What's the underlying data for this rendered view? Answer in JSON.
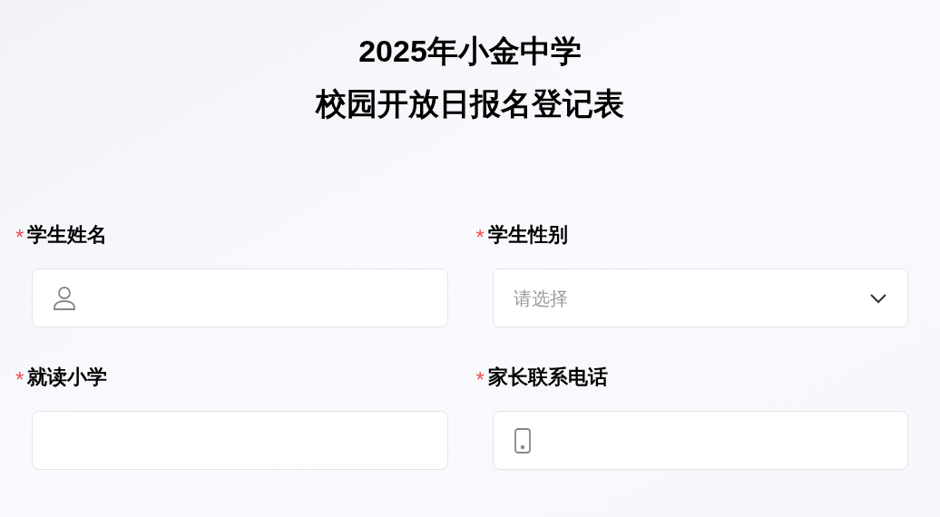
{
  "title_lines": [
    "2025年小金中学",
    "校园开放日报名登记表"
  ],
  "fields": [
    {
      "label": "学生姓名",
      "marker": "*",
      "kind": "person"
    },
    {
      "label": "学生性别",
      "marker": "*",
      "kind": "select",
      "placeholder": "请选择"
    },
    {
      "label": "就读小学",
      "marker": "*",
      "kind": "plain"
    },
    {
      "label": "家长联系电话",
      "marker": "*",
      "kind": "phone"
    }
  ]
}
